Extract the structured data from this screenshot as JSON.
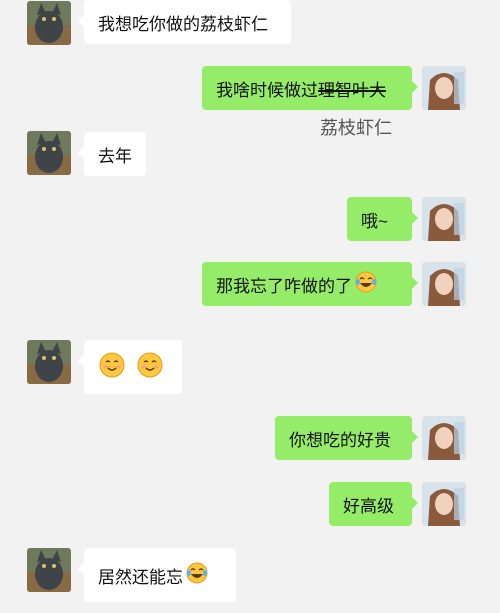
{
  "messages": [
    {
      "side": "left",
      "text": "我想吃你做的荔枝虾仁"
    },
    {
      "side": "right",
      "text_prefix": "我啥时候做过",
      "text_strike": "理智叶大",
      "annotation": "荔枝虾仁"
    },
    {
      "side": "left",
      "text": "去年"
    },
    {
      "side": "right",
      "text": "哦~"
    },
    {
      "side": "right",
      "text": "那我忘了咋做的了",
      "emoji": "laughing-crying-emoji"
    },
    {
      "side": "left",
      "text": "",
      "emoji": "smiling-face-emoji"
    },
    {
      "side": "right",
      "text": "你想吃的好贵"
    },
    {
      "side": "right",
      "text": "好高级"
    },
    {
      "side": "left",
      "text": "居然还能忘",
      "emoji": "laughing-crying-emoji"
    }
  ],
  "colors": {
    "background": "#f2f2f2",
    "incoming_bubble": "#ffffff",
    "outgoing_bubble": "#95ec69"
  }
}
